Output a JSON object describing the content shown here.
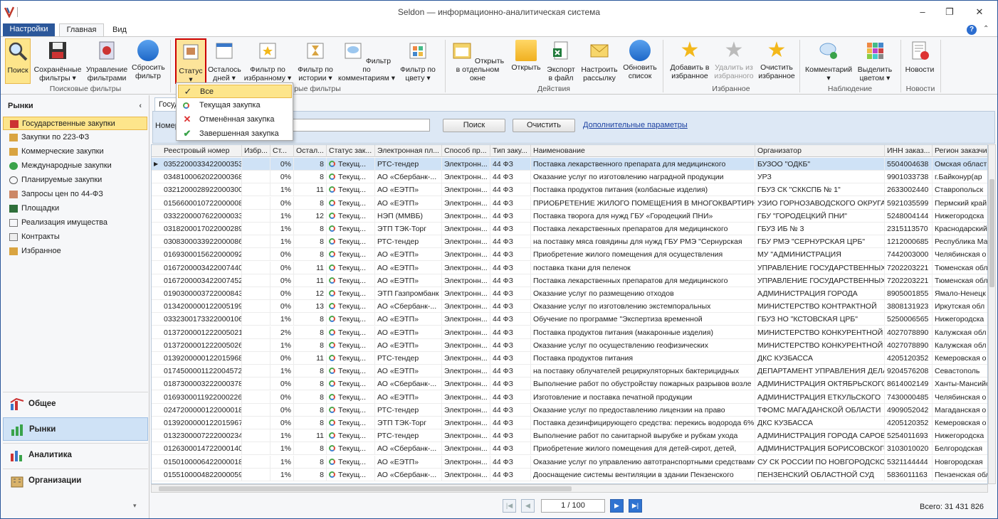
{
  "app": {
    "title": "Seldon — информационно-аналитическая система"
  },
  "tabs": {
    "file": "Настройки",
    "main": "Главная",
    "view": "Вид"
  },
  "ribbon": {
    "search": "Поиск",
    "saved": "Сохранённые фильтры ▾",
    "manage": "Управление фильтрами",
    "reset": "Сбросить фильтр",
    "group1": "Поисковые фильтры",
    "status": "Статус ▾",
    "days": "Осталось дней ▾",
    "fav_filter": "Фильтр по избранному ▾",
    "history": "Фильтр по истории ▾",
    "comments_filter": "Фильтр по комментариям ▾",
    "color": "Фильтр по цвету ▾",
    "group2": "рые фильтры",
    "open_window": "Открыть в отдельном окне",
    "open": "Открыть",
    "export": "Экспорт в файл",
    "mailing": "Настроить рассылку",
    "refresh": "Обновить список",
    "group3": "Действия",
    "add_fav": "Добавить в избранное",
    "remove_fav": "Удалить из избранного",
    "clear_fav": "Очистить избранное",
    "group4": "Избранное",
    "comment": "Комментарий ▾",
    "highlight": "Выделить цветом ▾",
    "group5": "Наблюдение",
    "news": "Новости",
    "group6": "Новости"
  },
  "status_menu": [
    "Все",
    "Текущая закупка",
    "Отменённая закупка",
    "Завершенная закупка"
  ],
  "sidebar": {
    "title": "Рынки",
    "items": [
      "Государственные закупки",
      "Закупки по 223-ФЗ",
      "Коммерческие закупки",
      "Международные закупки",
      "Планируемые закупки",
      "Запросы цен по 44-ФЗ",
      "Площадки",
      "Реализация имущества",
      "Контракты",
      "Избранное"
    ],
    "nav": [
      "Общее",
      "Рынки",
      "Аналитика",
      "Организации"
    ]
  },
  "panel": {
    "tab": "Государственные закупки",
    "number_label": "Номер",
    "search": "Поиск",
    "clear": "Очистить",
    "more": "Дополнительные параметры"
  },
  "columns": [
    "Реестровый номер",
    "Избр...",
    "Ст...",
    "Остал...",
    "Статус зак...",
    "Электронная пл...",
    "Способ пр...",
    "Тип заку...",
    "Наименование",
    "Организатор",
    "ИНН заказ...",
    "Регион заказчи..."
  ],
  "rows": [
    [
      "0352200033422000353",
      "0%",
      "8",
      "Текущ...",
      "РТС-тендер",
      "Электронн...",
      "44 ФЗ",
      "Поставка лекарственного препарата для медицинского",
      "БУЗОО \"ОДКБ\"",
      "5504004638",
      "Омская област"
    ],
    [
      "0348100062022000368",
      "0%",
      "8",
      "Текущ...",
      "АО «Сбербанк-...",
      "Электронн...",
      "44 ФЗ",
      "Оказание услуг по изготовлению наградной продукции",
      "УРЗ",
      "9901033738",
      "г.Байконур(ар"
    ],
    [
      "0321200028922000300",
      "1%",
      "11",
      "Текущ...",
      "АО «ЕЭТП»",
      "Электронн...",
      "44 ФЗ",
      "Поставка продуктов питания (колбасные изделия)",
      "ГБУЗ СК \"СККСПБ № 1\"",
      "2633002440",
      "Ставропольск"
    ],
    [
      "0156600010722000008",
      "0%",
      "8",
      "Текущ...",
      "АО «ЕЭТП»",
      "Электронн...",
      "44 ФЗ",
      "ПРИОБРЕТЕНИЕ ЖИЛОГО ПОМЕЩЕНИЯ В МНОГОКВАРТИРНОМ",
      "УЗИО ГОРНОЗАВОДСКОГО ОКРУГА",
      "5921035599",
      "Пермский край"
    ],
    [
      "0332200007622000033",
      "1%",
      "12",
      "Текущ...",
      "НЭП (ММВБ)",
      "Электронн...",
      "44 ФЗ",
      "Поставка творога для нужд ГБУ «Городецкий ПНИ»",
      "ГБУ \"ГОРОДЕЦКИЙ ПНИ\"",
      "5248004144",
      "Нижегородска"
    ],
    [
      "0318200017022000289",
      "1%",
      "8",
      "Текущ...",
      "ЭТП ТЭК-Торг",
      "Электронн...",
      "44 ФЗ",
      "Поставка лекарственных препаратов для медицинского",
      "ГБУЗ ИБ № 3",
      "2315113570",
      "Краснодарский"
    ],
    [
      "0308300033922000086",
      "1%",
      "8",
      "Текущ...",
      "РТС-тендер",
      "Электронн...",
      "44 ФЗ",
      "на поставку мяса говядины для нужд ГБУ РМЭ \"Сернурская",
      "ГБУ РМЭ \"СЕРНУРСКАЯ ЦРБ\"",
      "1212000685",
      "Республика Ма"
    ],
    [
      "0169300015622000092",
      "0%",
      "8",
      "Текущ...",
      "АО «ЕЭТП»",
      "Электронн...",
      "44 ФЗ",
      "Приобретение жилого помещения для осуществления",
      "МУ \"АДМИНИСТРАЦИЯ",
      "7442003000",
      "Челябинская о"
    ],
    [
      "0167200003422007440",
      "0%",
      "11",
      "Текущ...",
      "АО «ЕЭТП»",
      "Электронн...",
      "44 ФЗ",
      "поставка ткани для пеленок",
      "УПРАВЛЕНИЕ ГОСУДАРСТВЕННЫХ",
      "7202203221",
      "Тюменская обл"
    ],
    [
      "0167200003422007452",
      "0%",
      "11",
      "Текущ...",
      "АО «ЕЭТП»",
      "Электронн...",
      "44 ФЗ",
      "Поставка лекарственных препаратов для медицинского",
      "УПРАВЛЕНИЕ ГОСУДАРСТВЕННЫХ",
      "7202203221",
      "Тюменская обл"
    ],
    [
      "0190300003722000843",
      "0%",
      "12",
      "Текущ...",
      "ЭТП Газпромбанк",
      "Электронн...",
      "44 ФЗ",
      "Оказание услуг по размещению отходов",
      "АДМИНИСТРАЦИЯ ГОРОДА",
      "8905001855",
      "Ямало-Ненецк"
    ],
    [
      "0134200000122005199",
      "0%",
      "13",
      "Текущ...",
      "АО «Сбербанк-...",
      "Электронн...",
      "44 ФЗ",
      "Оказание услуг по изготовлению экстемпоральных",
      "МИНИСТЕРСТВО КОНТРАКТНОЙ",
      "3808131923",
      "Иркутская обл"
    ],
    [
      "0332300173322000106",
      "1%",
      "8",
      "Текущ...",
      "АО «ЕЭТП»",
      "Электронн...",
      "44 ФЗ",
      "Обучение по программе \"Экспертиза временной",
      "ГБУЗ НО \"КСТОВСКАЯ ЦРБ\"",
      "5250006565",
      "Нижегородска"
    ],
    [
      "0137200001222005021",
      "2%",
      "8",
      "Текущ...",
      "АО «ЕЭТП»",
      "Электронн...",
      "44 ФЗ",
      "Поставка продуктов питания (макаронные изделия)",
      "МИНИСТЕРСТВО КОНКУРЕНТНОЙ",
      "4027078890",
      "Калужская обл"
    ],
    [
      "0137200001222005026",
      "1%",
      "8",
      "Текущ...",
      "АО «ЕЭТП»",
      "Электронн...",
      "44 ФЗ",
      "Оказание услуг по осуществлению геофизических",
      "МИНИСТЕРСТВО КОНКУРЕНТНОЙ",
      "4027078890",
      "Калужская обл"
    ],
    [
      "0139200000122015968",
      "0%",
      "11",
      "Текущ...",
      "РТС-тендер",
      "Электронн...",
      "44 ФЗ",
      "Поставка продуктов питания",
      "ДКС КУЗБАССА",
      "4205120352",
      "Кемеровская о"
    ],
    [
      "0174500001122004572",
      "1%",
      "8",
      "Текущ...",
      "АО «ЕЭТП»",
      "Электронн...",
      "44 ФЗ",
      "на поставку облучателей рециркуляторных бактерицидных",
      "ДЕПАРТАМЕНТ УПРАВЛЕНИЯ ДЕЛАМИ",
      "9204576208",
      "Севастополь"
    ],
    [
      "0187300003222000378",
      "0%",
      "8",
      "Текущ...",
      "АО «Сбербанк-...",
      "Электронн...",
      "44 ФЗ",
      "Выполнение работ по обустройству пожарных разрывов возле",
      "АДМИНИСТРАЦИЯ ОКТЯБРЬСКОГО",
      "8614002149",
      "Ханты-Мансийс"
    ],
    [
      "0169300011922000226",
      "0%",
      "8",
      "Текущ...",
      "АО «ЕЭТП»",
      "Электронн...",
      "44 ФЗ",
      "Изготовление и поставка печатной продукции",
      "АДМИНИСТРАЦИЯ ЕТКУЛЬСКОГО",
      "7430000485",
      "Челябинская о"
    ],
    [
      "0247200000122000018",
      "0%",
      "8",
      "Текущ...",
      "РТС-тендер",
      "Электронн...",
      "44 ФЗ",
      "Оказание услуг по предоставлению лицензии на право",
      "ТФОМС МАГАДАНСКОЙ ОБЛАСТИ",
      "4909052042",
      "Магаданская о"
    ],
    [
      "0139200000122015967",
      "0%",
      "8",
      "Текущ...",
      "ЭТП ТЭК-Торг",
      "Электронн...",
      "44 ФЗ",
      "Поставка дезинфицирующего средства: перекись водорода 6%",
      "ДКС КУЗБАССА",
      "4205120352",
      "Кемеровская о"
    ],
    [
      "0132300007222000234",
      "1%",
      "11",
      "Текущ...",
      "РТС-тендер",
      "Электронн...",
      "44 ФЗ",
      "Выполнение работ по санитарной вырубке и рубкам ухода",
      "АДМИНИСТРАЦИЯ ГОРОДА САРОВА",
      "5254011693",
      "Нижегородска"
    ],
    [
      "0126300014722000140",
      "1%",
      "8",
      "Текущ...",
      "АО «Сбербанк-...",
      "Электронн...",
      "44 ФЗ",
      "Приобретение жилого помещения для детей-сирот, детей,",
      "АДМИНИСТРАЦИЯ БОРИСОВСКОГО",
      "3103010020",
      "Белгородская"
    ],
    [
      "0150100006422000018",
      "1%",
      "8",
      "Текущ...",
      "АО «ЕЭТП»",
      "Электронн...",
      "44 ФЗ",
      "Оказание услуг по управлению автотранспортными средствами",
      "СУ СК РОССИИ ПО НОВГОРОДСКОЙ",
      "5321144444",
      "Новгородская"
    ],
    [
      "0155100004822000059",
      "1%",
      "8",
      "Текущ...",
      "АО «Сбербанк-...",
      "Электронн...",
      "44 ФЗ",
      "Дооснащение системы вентиляции в здании Пензенского",
      "ПЕНЗЕНСКИЙ ОБЛАСТНОЙ СУД",
      "5836011163",
      "Пензенская обл"
    ]
  ],
  "pager": {
    "page": "1 / 100",
    "total": "Всего:  31 431 826"
  }
}
